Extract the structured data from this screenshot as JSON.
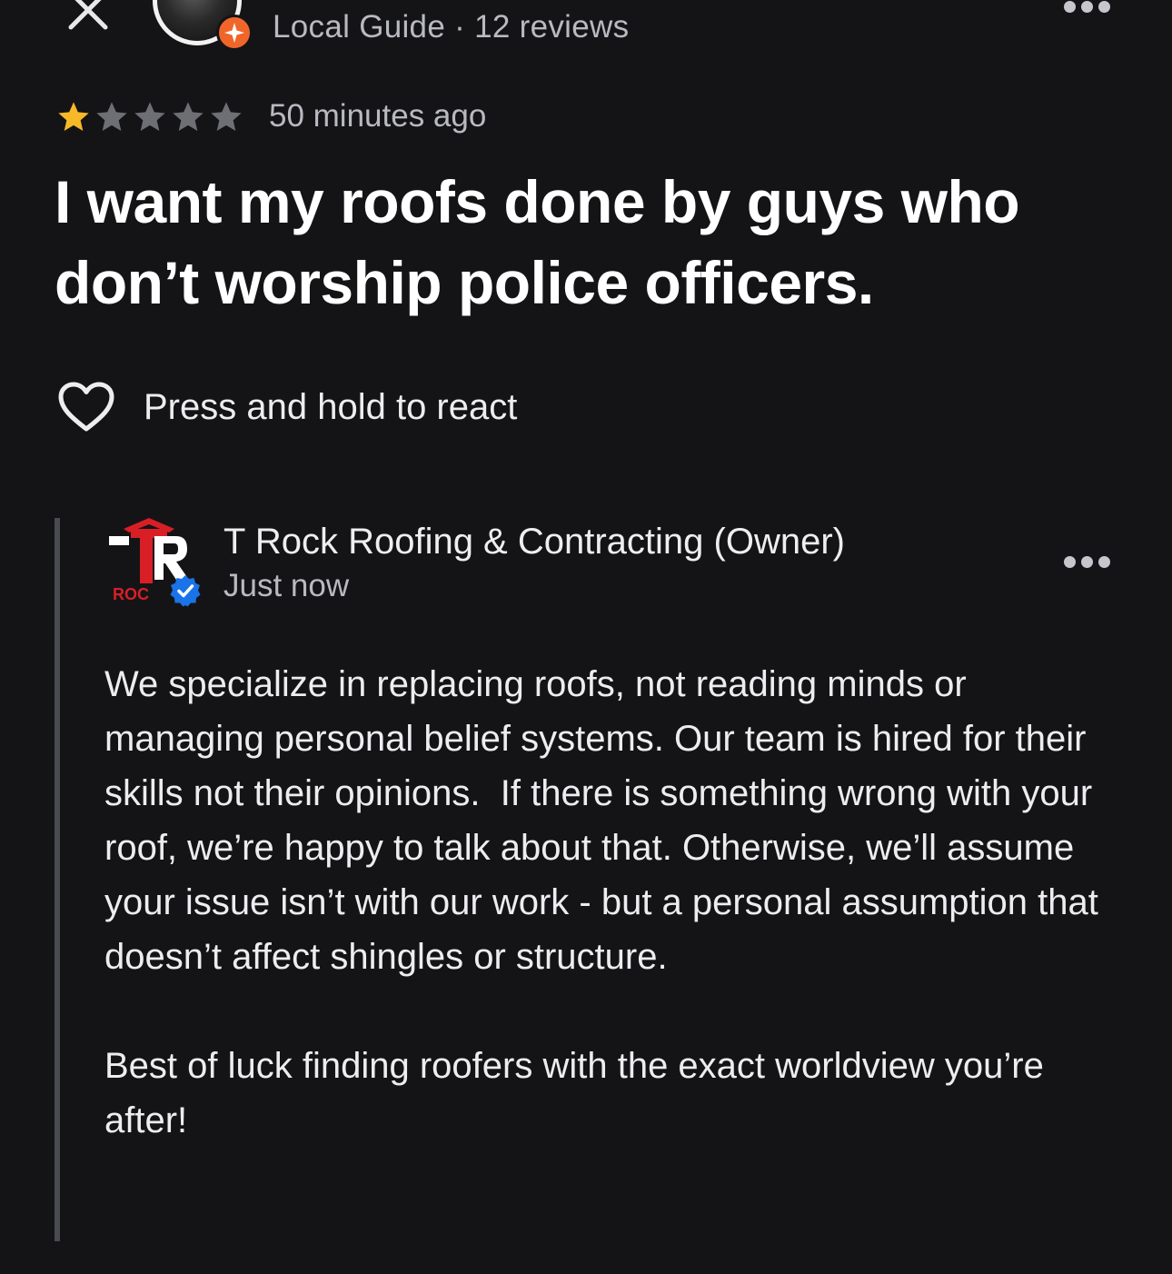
{
  "header": {
    "reviewer_meta": "Local Guide · 12 reviews"
  },
  "review": {
    "rating": 1,
    "max_rating": 5,
    "star_color_filled": "#f7b928",
    "star_color_empty": "#6e6f74",
    "time": "50 minutes ago",
    "text": "I want my roofs done by guys who don’t worship police officers."
  },
  "reaction": {
    "label": "Press and hold to react"
  },
  "owner_response": {
    "name": "T Rock Roofing & Contracting (Owner)",
    "time": "Just now",
    "logo_text": "ROC",
    "paragraphs": [
      "We specialize in replacing roofs, not reading minds or managing personal belief systems. Our team is hired for their skills not their opinions.  If there is something wrong with your roof, we’re happy to talk about that. Otherwise, we’ll assume your issue isn’t with our work - but a personal assumption that doesn’t affect shingles or structure.",
      "Best of luck finding roofers with the exact worldview you’re after!"
    ]
  },
  "colors": {
    "background": "#141417",
    "local_guide_badge": "#f0662a",
    "verified_badge": "#1a73e8",
    "logo_red": "#d81f26"
  }
}
